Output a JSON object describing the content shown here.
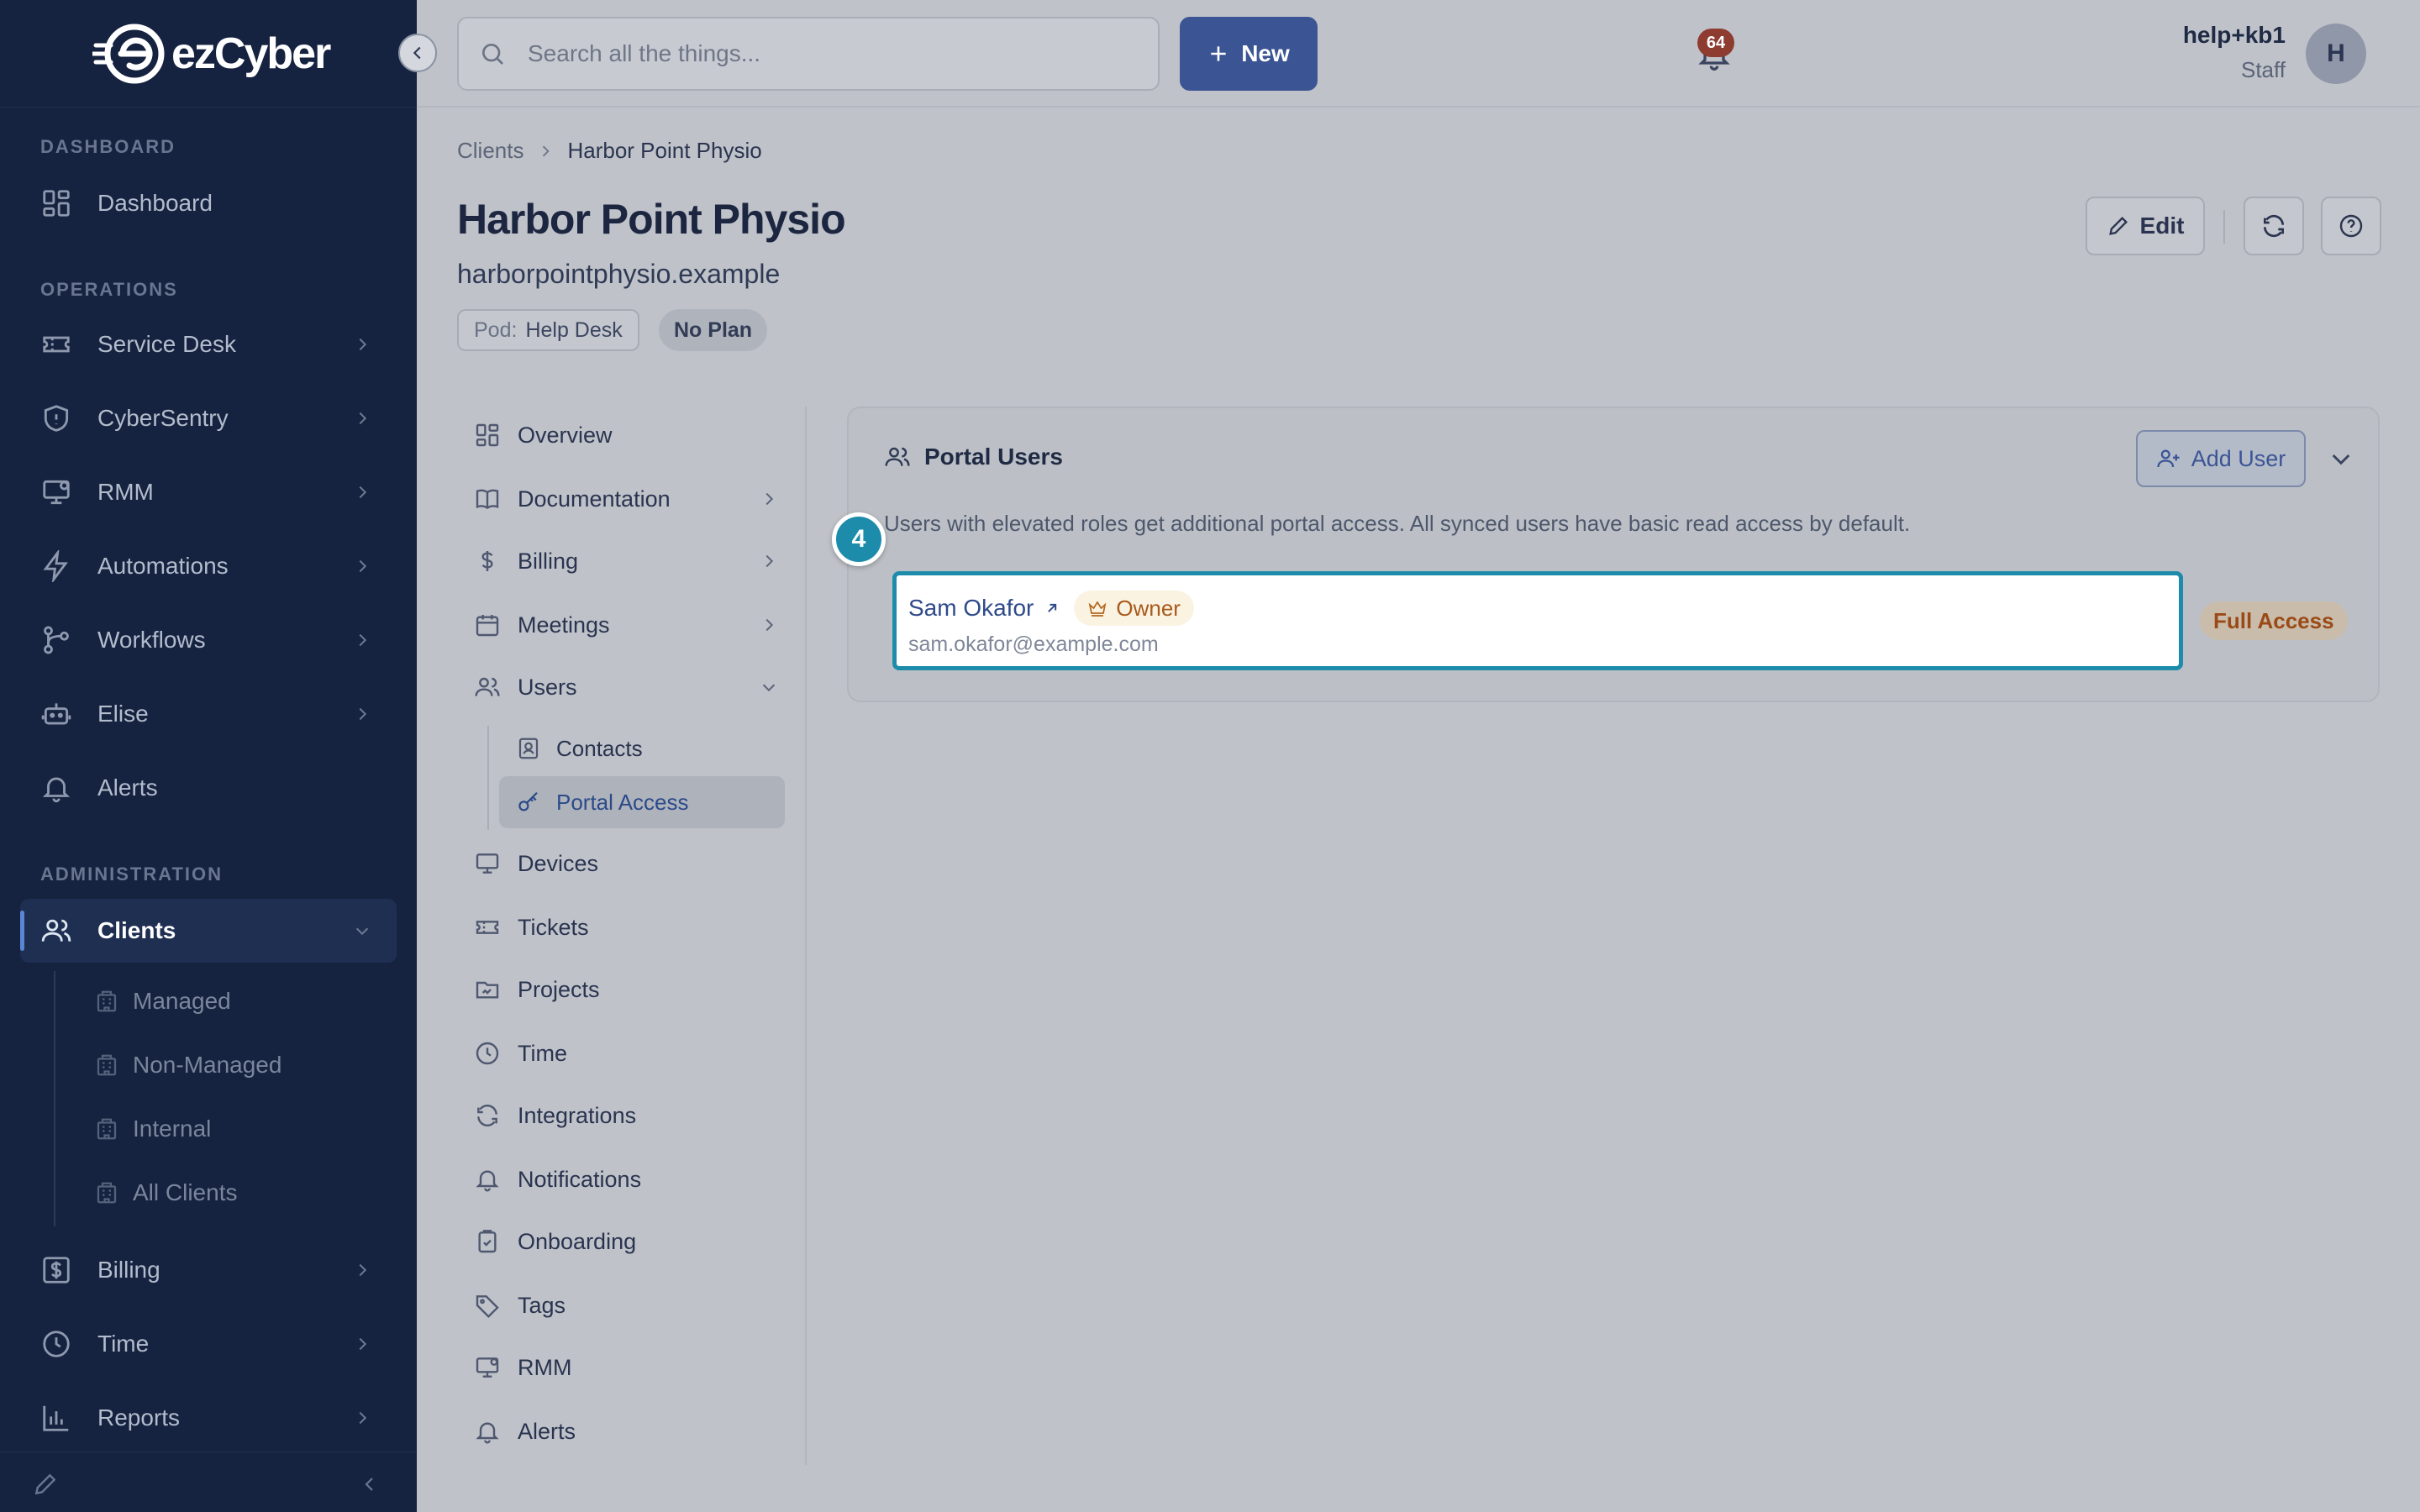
{
  "app": {
    "brand": "ezCyber"
  },
  "topbar": {
    "search_placeholder": "Search all the things...",
    "new_label": "New",
    "notifications_count": "64",
    "user_name": "help+kb1",
    "user_role": "Staff",
    "avatar_initial": "H"
  },
  "sidebar": {
    "sections": {
      "dashboard": "DASHBOARD",
      "operations": "OPERATIONS",
      "administration": "ADMINISTRATION"
    },
    "items": [
      {
        "label": "Dashboard",
        "icon": "dashboard-icon"
      },
      {
        "label": "Service Desk",
        "icon": "ticket-icon"
      },
      {
        "label": "CyberSentry",
        "icon": "shield-icon"
      },
      {
        "label": "RMM",
        "icon": "monitor-icon"
      },
      {
        "label": "Automations",
        "icon": "bolt-icon"
      },
      {
        "label": "Workflows",
        "icon": "workflow-icon"
      },
      {
        "label": "Elise",
        "icon": "robot-icon"
      },
      {
        "label": "Alerts",
        "icon": "bell-icon"
      },
      {
        "label": "Clients",
        "icon": "users-icon"
      },
      {
        "label": "Billing",
        "icon": "dollar-icon"
      },
      {
        "label": "Time",
        "icon": "clock-icon"
      },
      {
        "label": "Reports",
        "icon": "chart-icon"
      }
    ],
    "client_subitems": [
      "Managed",
      "Non-Managed",
      "Internal",
      "All Clients"
    ]
  },
  "breadcrumb": {
    "parent": "Clients",
    "current": "Harbor Point Physio"
  },
  "page": {
    "title": "Harbor Point Physio",
    "domain": "harborpointphysio.example",
    "pod_key": "Pod:",
    "pod_value": "Help Desk",
    "plan": "No Plan",
    "edit_label": "Edit"
  },
  "subnav": {
    "items": [
      "Overview",
      "Documentation",
      "Billing",
      "Meetings",
      "Users",
      "Devices",
      "Tickets",
      "Projects",
      "Time",
      "Integrations",
      "Notifications",
      "Onboarding",
      "Tags",
      "RMM",
      "Alerts"
    ],
    "users_subitems": [
      "Contacts",
      "Portal Access"
    ]
  },
  "portal_users": {
    "title": "Portal Users",
    "add_user_label": "Add User",
    "description": "Users with elevated roles get additional portal access. All synced users have basic read access by default.",
    "users": [
      {
        "name": "Sam Okafor",
        "role": "Owner",
        "email": "sam.okafor@example.com",
        "access": "Full Access"
      }
    ]
  },
  "walkthrough": {
    "step": "4"
  },
  "colors": {
    "sidebar_bg": "#152340",
    "primary": "#3b5494",
    "highlight": "#1d8cab",
    "owner_badge_text": "#a85a1c",
    "access_badge_text": "#9a4a16"
  }
}
